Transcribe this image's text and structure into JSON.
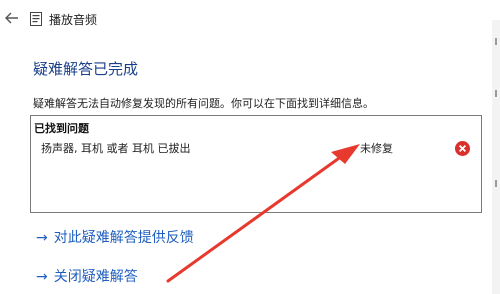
{
  "window": {
    "title": "播放音频",
    "back_icon": "back-arrow-icon",
    "app_icon": "document-icon"
  },
  "page": {
    "heading": "疑难解答已完成",
    "description": "疑难解答无法自动修复发现的所有问题。你可以在下面找到详细信息。"
  },
  "results": {
    "header": "已找到问题",
    "problems": [
      {
        "text": "扬声器, 耳机 或者 耳机 已拔出",
        "status": "未修复",
        "status_icon": "error-icon",
        "status_color": "#d9302c"
      }
    ]
  },
  "links": [
    {
      "arrow": "→",
      "label": "对此疑难解答提供反馈"
    },
    {
      "arrow": "→",
      "label": "关闭疑难解答"
    }
  ],
  "colors": {
    "heading": "#1a3f8a",
    "link": "#1f5fbf",
    "annotation_arrow": "#e8392e"
  }
}
